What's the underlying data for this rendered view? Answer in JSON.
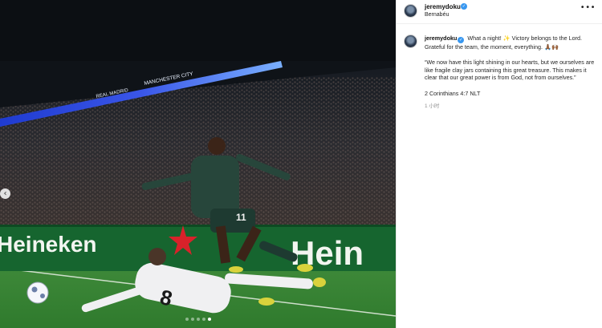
{
  "post": {
    "username": "jeremydoku",
    "location": "Bernabéu",
    "more_icon": "•••",
    "caption_text": "What a night! ✨ Victory belongs to the Lord. Grateful for the team, the moment, everything. 🙏🏾🙌🏾",
    "quote": "“We now have this light shining in our hearts, but we ourselves are like fragile clay jars containing this great treasure. This makes it clear that our great power is from God, not from ourselves.”",
    "reference": "2 Corinthians 4:7 NLT",
    "time": "1 小时",
    "colors": {
      "verified": "#3897f0",
      "media_background": "#0c0f13"
    }
  },
  "media": {
    "prev_icon": "‹",
    "board_texts": [
      "Heineken",
      "Hein",
      "MANCHESTER CITY",
      "REAL MADRID"
    ],
    "player_number_green": "11",
    "player_number_white": "8",
    "carousel": {
      "total": 5,
      "active": 5
    }
  }
}
